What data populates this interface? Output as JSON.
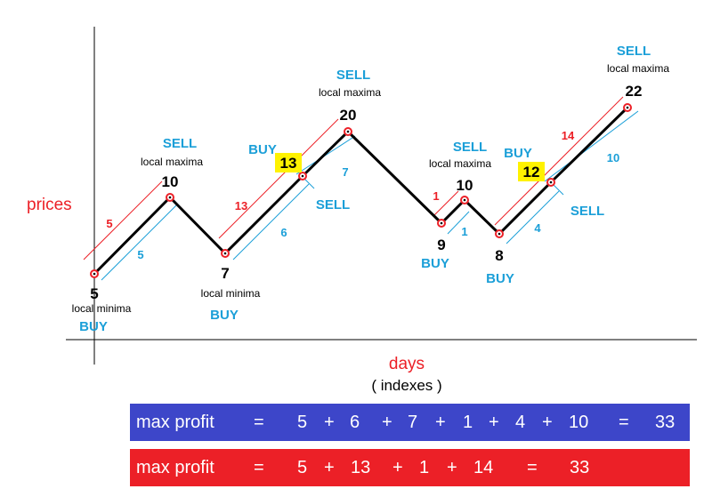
{
  "axes": {
    "y_label": "prices",
    "x_label": "days",
    "x_sublabel": "( indexes )"
  },
  "price_path": [
    5,
    10,
    7,
    13,
    20,
    9,
    10,
    8,
    12,
    22
  ],
  "point_labels": {
    "p5": "5",
    "p10a": "10",
    "p7": "7",
    "p13": "13",
    "p20": "20",
    "p9": "9",
    "p10b": "10",
    "p8": "8",
    "p12": "12",
    "p22": "22"
  },
  "notes": {
    "local_minima": "local minima",
    "local_maxima": "local maxima",
    "buy": "BUY",
    "sell": "SELL"
  },
  "red_gains": [
    "5",
    "13",
    "1",
    "14"
  ],
  "blue_gains": [
    "5",
    "6",
    "7",
    "1",
    "4",
    "10"
  ],
  "colors": {
    "price_line": "#000000",
    "red": "#ec2027",
    "blue": "#1b9fd8",
    "highlight": "#fff200",
    "blue_bar": "#3d46c9",
    "red_bar": "#ec2027"
  },
  "summary_blue": {
    "label": "max  profit",
    "eq": "=",
    "terms": [
      "5",
      "6",
      "7",
      "1",
      "4",
      "10"
    ],
    "plus": "+",
    "total": "33"
  },
  "summary_red": {
    "label": "max  profit",
    "eq": "=",
    "terms": [
      "5",
      "13",
      "1",
      "14"
    ],
    "plus": "+",
    "total": "33"
  }
}
